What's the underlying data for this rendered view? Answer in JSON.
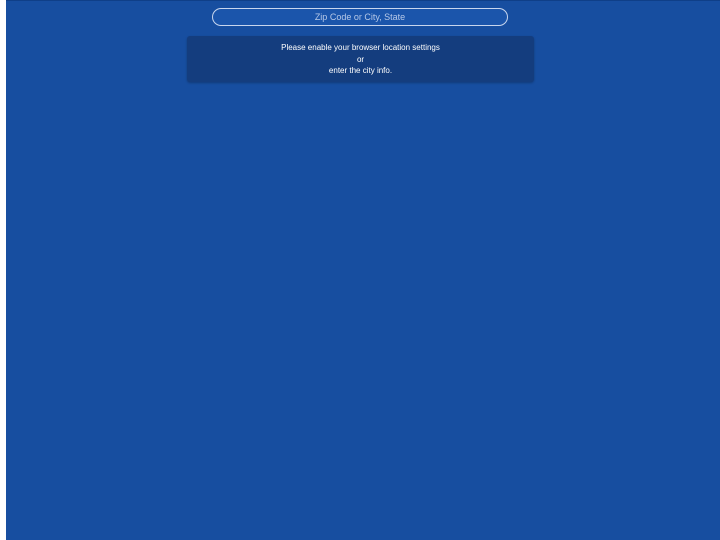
{
  "search": {
    "placeholder": "Zip Code or City, State",
    "value": ""
  },
  "message": {
    "line1": "Please enable your browser location settings",
    "line2": "or",
    "line3": "enter the city info."
  },
  "colors": {
    "background": "#174ea0",
    "message_box": "#143d7e",
    "input_border": "#c8d6ee",
    "text": "#ffffff"
  }
}
